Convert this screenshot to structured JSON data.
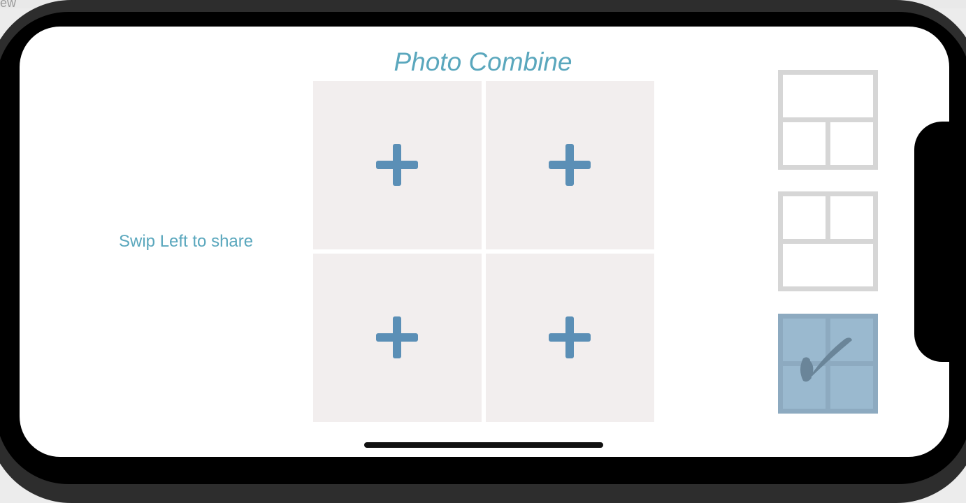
{
  "backdrop": {
    "partial_text": "ew"
  },
  "app": {
    "title": "Photo Combine",
    "swipe_hint": "Swip Left to share"
  },
  "grid": {
    "cells": [
      {
        "icon": "plus-icon"
      },
      {
        "icon": "plus-icon"
      },
      {
        "icon": "plus-icon"
      },
      {
        "icon": "plus-icon"
      }
    ]
  },
  "layouts": {
    "options": [
      {
        "name": "one-top-two-bottom",
        "selected": false
      },
      {
        "name": "two-top-one-bottom",
        "selected": false
      },
      {
        "name": "two-by-two",
        "selected": true,
        "icon": "checkmark-icon"
      }
    ]
  },
  "colors": {
    "accent_text": "#5aa7bd",
    "plus_icon": "#5b8fb6",
    "cell_background": "#f2eeee",
    "layout_outline": "#d6d6d6",
    "selected_layout": "#9ab9cf"
  }
}
